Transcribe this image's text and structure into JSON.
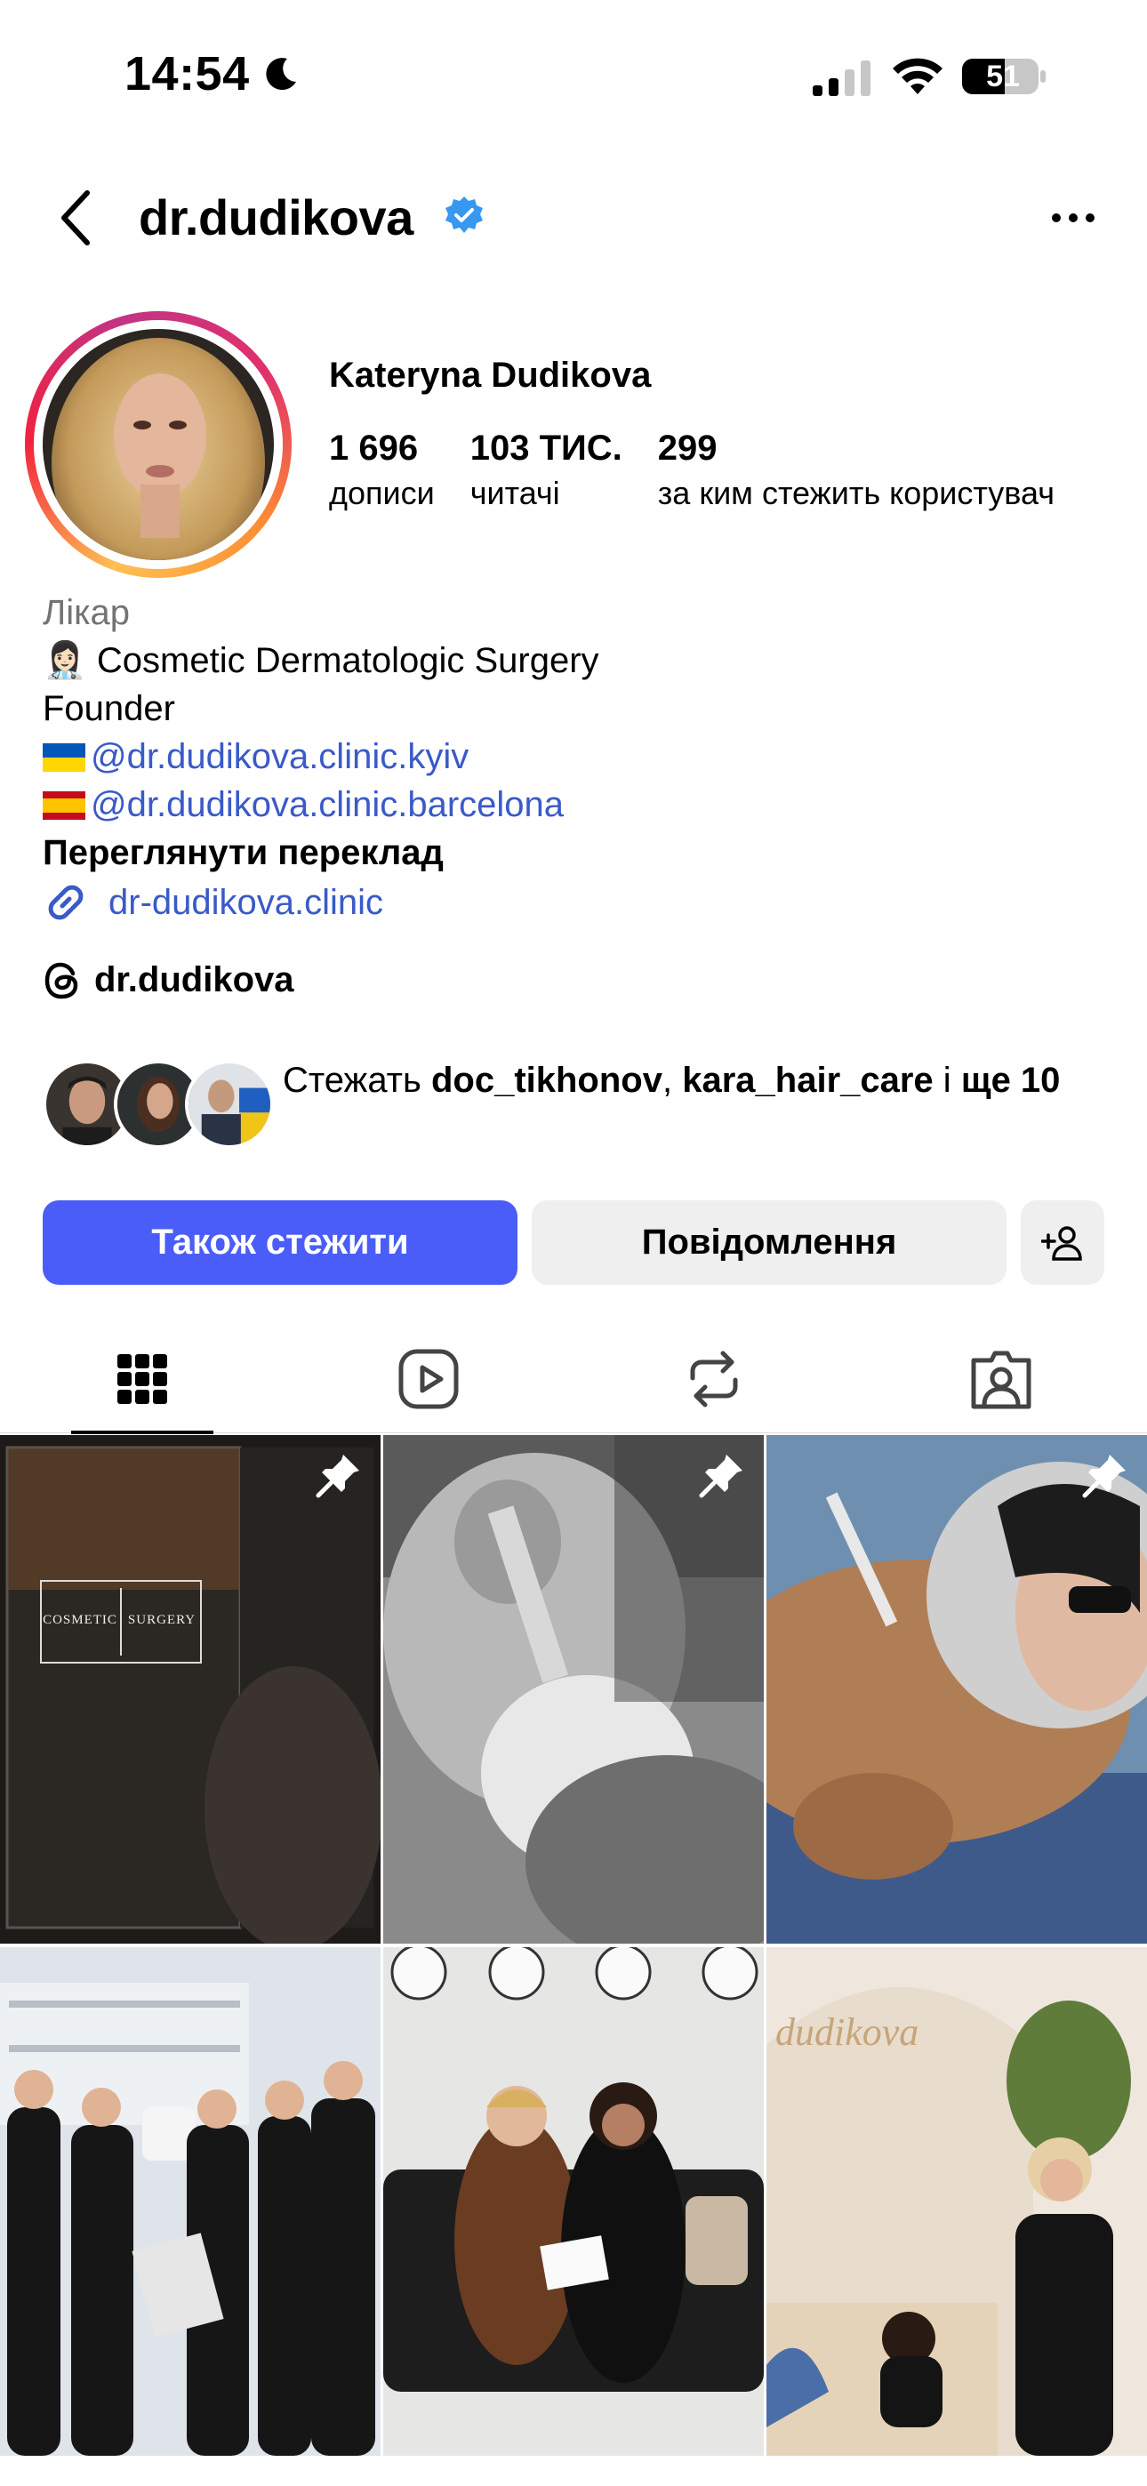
{
  "status_bar": {
    "time": "14:54",
    "battery": "51"
  },
  "header": {
    "username": "dr.dudikova"
  },
  "profile": {
    "full_name": "Kateryna Dudikova",
    "stats": [
      {
        "value": "1 696",
        "label": "дописи"
      },
      {
        "value": "103 ТИС.",
        "label": "читачі"
      },
      {
        "value": "299",
        "label": "за ким стежить користувач"
      }
    ],
    "bio": {
      "category": "Лікар",
      "line1": "👩🏻‍⚕️ Cosmetic Dermatologic Surgery",
      "line2": "Founder",
      "mention1": "@dr.dudikova.clinic.kyiv",
      "mention2": "@dr.dudikova.clinic.barcelona",
      "translate": "Переглянути переклад",
      "link": "dr-dudikova.clinic"
    },
    "threads_handle": "dr.dudikova",
    "followed_by": {
      "prefix": "Стежать ",
      "user1": "doc_tikhonov",
      "sep": ", ",
      "user2": "kara_hair_care",
      "mid": " і ",
      "rest": "ще 10"
    }
  },
  "actions": {
    "follow_label": "Також стежити",
    "message_label": "Повідомлення"
  },
  "colors": {
    "accent": "#4a5df9",
    "link": "#3a5ac8",
    "verified": "#3897f0"
  },
  "tabs": [
    {
      "icon": "grid-icon",
      "active": true
    },
    {
      "icon": "reels-icon",
      "active": false
    },
    {
      "icon": "reposts-icon",
      "active": false
    },
    {
      "icon": "tagged-icon",
      "active": false
    }
  ],
  "posts": [
    {
      "pinned": true,
      "caption_lines": [
        "COSMETIC",
        "SURGERY"
      ]
    },
    {
      "pinned": true
    },
    {
      "pinned": true
    },
    {
      "pinned": false
    },
    {
      "pinned": false
    },
    {
      "pinned": false,
      "sign_text": "dudikova"
    }
  ]
}
